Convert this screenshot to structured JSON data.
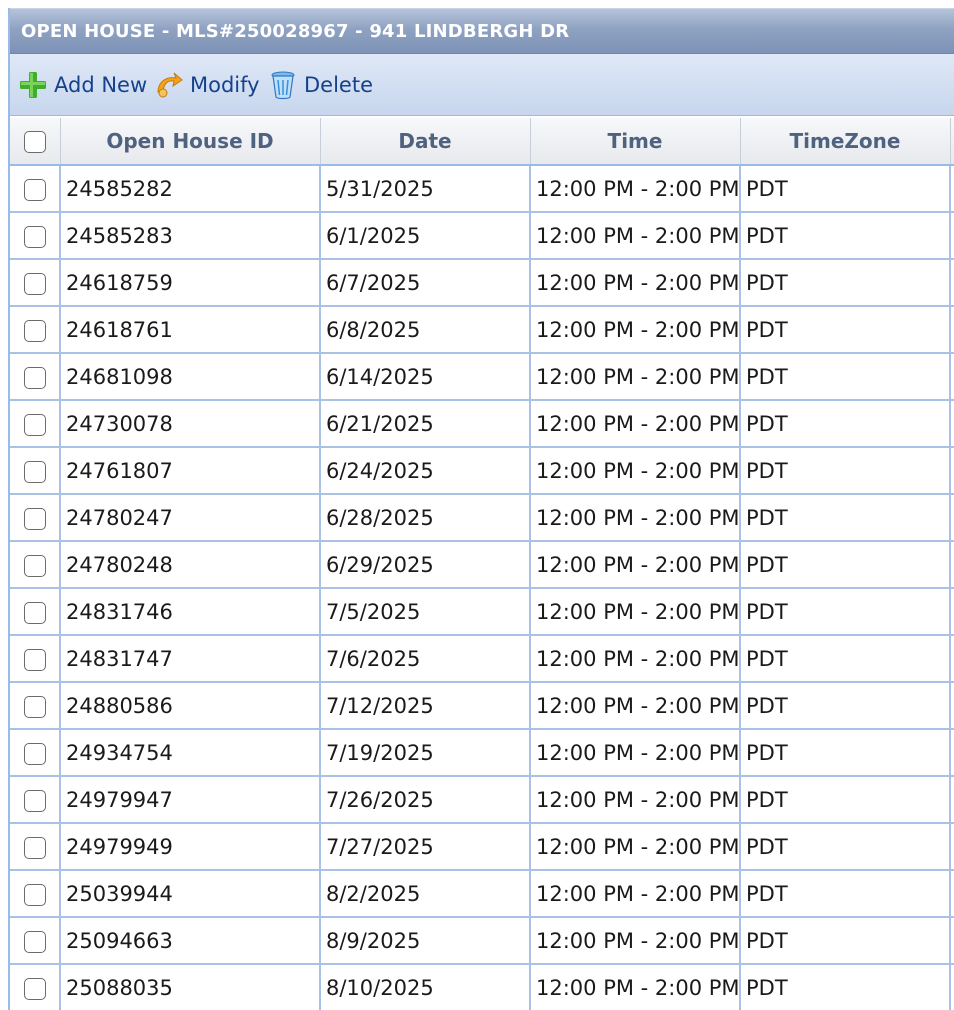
{
  "panel": {
    "title": "OPEN HOUSE - MLS#250028967 - 941 LINDBERGH DR"
  },
  "toolbar": {
    "add_label": "Add New",
    "modify_label": "Modify",
    "delete_label": "Delete"
  },
  "grid": {
    "columns": [
      "Open House ID",
      "Date",
      "Time",
      "TimeZone"
    ],
    "rows": [
      {
        "id": "24585282",
        "date": "5/31/2025",
        "time": "12:00 PM - 2:00 PM",
        "tz": "PDT"
      },
      {
        "id": "24585283",
        "date": "6/1/2025",
        "time": "12:00 PM - 2:00 PM",
        "tz": "PDT"
      },
      {
        "id": "24618759",
        "date": "6/7/2025",
        "time": "12:00 PM - 2:00 PM",
        "tz": "PDT"
      },
      {
        "id": "24618761",
        "date": "6/8/2025",
        "time": "12:00 PM - 2:00 PM",
        "tz": "PDT"
      },
      {
        "id": "24681098",
        "date": "6/14/2025",
        "time": "12:00 PM - 2:00 PM",
        "tz": "PDT"
      },
      {
        "id": "24730078",
        "date": "6/21/2025",
        "time": "12:00 PM - 2:00 PM",
        "tz": "PDT"
      },
      {
        "id": "24761807",
        "date": "6/24/2025",
        "time": "12:00 PM - 2:00 PM",
        "tz": "PDT"
      },
      {
        "id": "24780247",
        "date": "6/28/2025",
        "time": "12:00 PM - 2:00 PM",
        "tz": "PDT"
      },
      {
        "id": "24780248",
        "date": "6/29/2025",
        "time": "12:00 PM - 2:00 PM",
        "tz": "PDT"
      },
      {
        "id": "24831746",
        "date": "7/5/2025",
        "time": "12:00 PM - 2:00 PM",
        "tz": "PDT"
      },
      {
        "id": "24831747",
        "date": "7/6/2025",
        "time": "12:00 PM - 2:00 PM",
        "tz": "PDT"
      },
      {
        "id": "24880586",
        "date": "7/12/2025",
        "time": "12:00 PM - 2:00 PM",
        "tz": "PDT"
      },
      {
        "id": "24934754",
        "date": "7/19/2025",
        "time": "12:00 PM - 2:00 PM",
        "tz": "PDT"
      },
      {
        "id": "24979947",
        "date": "7/26/2025",
        "time": "12:00 PM - 2:00 PM",
        "tz": "PDT"
      },
      {
        "id": "24979949",
        "date": "7/27/2025",
        "time": "12:00 PM - 2:00 PM",
        "tz": "PDT"
      },
      {
        "id": "25039944",
        "date": "8/2/2025",
        "time": "12:00 PM - 2:00 PM",
        "tz": "PDT"
      },
      {
        "id": "25094663",
        "date": "8/9/2025",
        "time": "12:00 PM - 2:00 PM",
        "tz": "PDT"
      },
      {
        "id": "25088035",
        "date": "8/10/2025",
        "time": "12:00 PM - 2:00 PM",
        "tz": "PDT"
      }
    ]
  },
  "icons": {
    "add": "plus-icon",
    "modify": "edit-icon",
    "delete": "trash-icon"
  },
  "colors": {
    "title_text": "#ffffff",
    "toolbar_text": "#15428b",
    "grid_border": "#a9c1e6",
    "add_icon": "#3fae2a",
    "modify_icon": "#f2a31b",
    "delete_icon": "#3a8fd6"
  }
}
